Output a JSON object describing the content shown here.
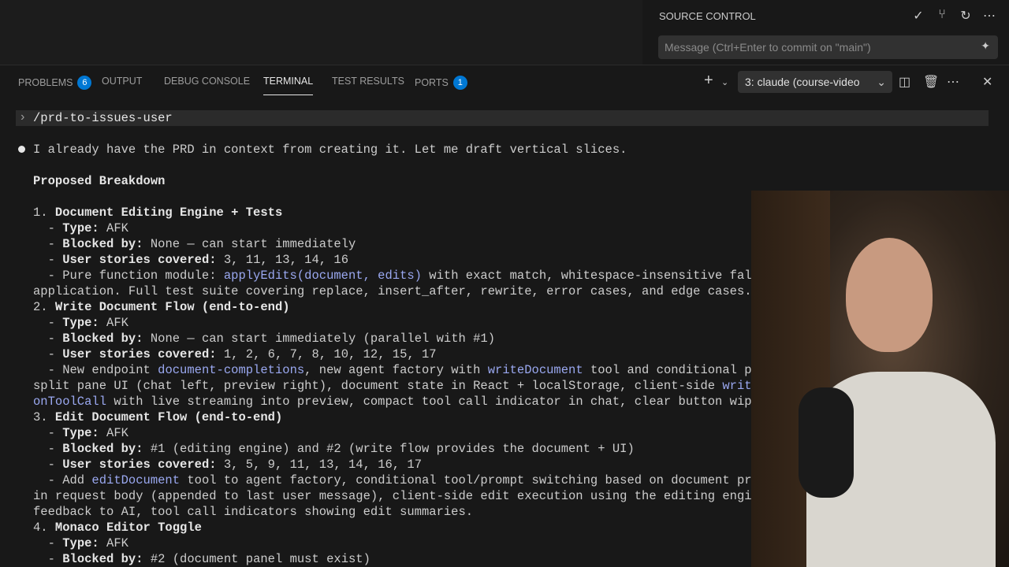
{
  "source_control": {
    "title": "SOURCE CONTROL",
    "message_placeholder": "Message (Ctrl+Enter to commit on \"main\")",
    "icons": [
      "check-icon",
      "git-pull-request-create-icon",
      "refresh-icon",
      "more-icon"
    ]
  },
  "panel": {
    "tabs": [
      {
        "label": "PROBLEMS",
        "badge": "6"
      },
      {
        "label": "OUTPUT"
      },
      {
        "label": "DEBUG CONSOLE"
      },
      {
        "label": "TERMINAL",
        "active": true
      },
      {
        "label": "TEST RESULTS"
      },
      {
        "label": "PORTS",
        "badge": "1"
      }
    ],
    "terminal_select": "3: claude (course-video",
    "accent": "#0078d4"
  },
  "terminal": {
    "command": "/prd-to-issues-user",
    "lines": [
      [
        [
          "n",
          "I already have the PRD in context from creating it. Let me draft vertical slices."
        ]
      ],
      [
        [
          "b",
          "Proposed Breakdown"
        ]
      ],
      [
        [
          "n",
          "1. "
        ],
        [
          "b",
          "Document Editing Engine + Tests"
        ]
      ],
      [
        [
          "n",
          "  - "
        ],
        [
          "b",
          "Type:"
        ],
        [
          "n",
          " AFK"
        ]
      ],
      [
        [
          "n",
          "  - "
        ],
        [
          "b",
          "Blocked by:"
        ],
        [
          "n",
          " None — can start immediately"
        ]
      ],
      [
        [
          "n",
          "  - "
        ],
        [
          "b",
          "User stories covered:"
        ],
        [
          "n",
          " 3, 11, 13, 14, 16"
        ]
      ],
      [
        [
          "n",
          "  - Pure function module: "
        ],
        [
          "c",
          "applyEdits(document, edits)"
        ],
        [
          "n",
          " with exact match, whitespace-insensitive fal"
        ]
      ],
      [
        [
          "n",
          "application. Full test suite covering replace, insert_after, rewrite, error cases, and edge cases."
        ]
      ],
      [
        [
          "n",
          "2. "
        ],
        [
          "b",
          "Write Document Flow (end-to-end)"
        ]
      ],
      [
        [
          "n",
          "  - "
        ],
        [
          "b",
          "Type:"
        ],
        [
          "n",
          " AFK"
        ]
      ],
      [
        [
          "n",
          "  - "
        ],
        [
          "b",
          "Blocked by:"
        ],
        [
          "n",
          " None — can start immediately (parallel with #1)"
        ]
      ],
      [
        [
          "n",
          "  - "
        ],
        [
          "b",
          "User stories covered:"
        ],
        [
          "n",
          " 1, 2, 6, 7, 8, 10, 12, 15, 17"
        ]
      ],
      [
        [
          "n",
          "  - New endpoint "
        ],
        [
          "c",
          "document-completions"
        ],
        [
          "n",
          ", new agent factory with "
        ],
        [
          "c",
          "writeDocument"
        ],
        [
          "n",
          " tool and conditional p"
        ]
      ],
      [
        [
          "n",
          "split pane UI (chat left, preview right), document state in React + localStorage, client-side "
        ],
        [
          "c",
          "writ"
        ]
      ],
      [
        [
          "c",
          "onToolCall"
        ],
        [
          "n",
          " with live streaming into preview, compact tool call indicator in chat, clear button wip"
        ]
      ],
      [
        [
          "n",
          "3. "
        ],
        [
          "b",
          "Edit Document Flow (end-to-end)"
        ]
      ],
      [
        [
          "n",
          "  - "
        ],
        [
          "b",
          "Type:"
        ],
        [
          "n",
          " AFK"
        ]
      ],
      [
        [
          "n",
          "  - "
        ],
        [
          "b",
          "Blocked by:"
        ],
        [
          "n",
          " #1 (editing engine) and #2 (write flow provides the document + UI)"
        ]
      ],
      [
        [
          "n",
          "  - "
        ],
        [
          "b",
          "User stories covered:"
        ],
        [
          "n",
          " 3, 5, 9, 11, 13, 14, 16, 17"
        ]
      ],
      [
        [
          "n",
          "  - Add "
        ],
        [
          "c",
          "editDocument"
        ],
        [
          "n",
          " tool to agent factory, conditional tool/prompt switching based on document pr"
        ]
      ],
      [
        [
          "n",
          "in request body (appended to last user message), client-side edit execution using the editing engi"
        ]
      ],
      [
        [
          "n",
          "feedback to AI, tool call indicators showing edit summaries."
        ]
      ],
      [
        [
          "n",
          "4. "
        ],
        [
          "b",
          "Monaco Editor Toggle"
        ]
      ],
      [
        [
          "n",
          "  - "
        ],
        [
          "b",
          "Type:"
        ],
        [
          "n",
          " AFK"
        ]
      ],
      [
        [
          "n",
          "  - "
        ],
        [
          "b",
          "Blocked by:"
        ],
        [
          "n",
          " #2 (document panel must exist)"
        ]
      ]
    ]
  }
}
